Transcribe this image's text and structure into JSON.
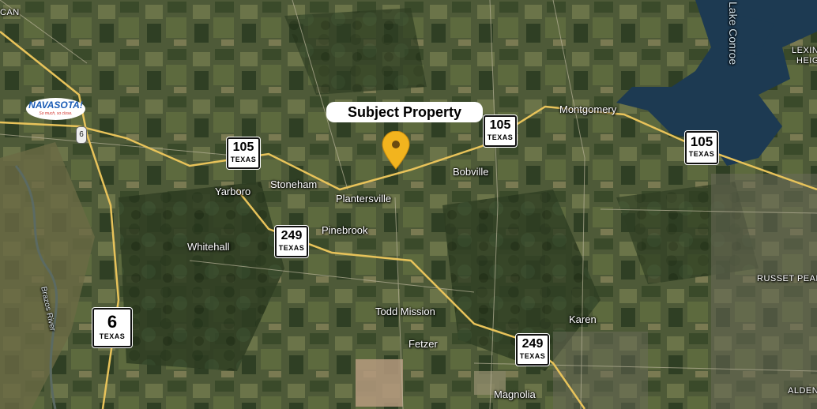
{
  "subject": {
    "label": "Subject Property"
  },
  "places": {
    "montgomery": "Montgomery",
    "bobville": "Bobville",
    "stoneham": "Stoneham",
    "plantersville": "Plantersville",
    "yarboro": "Yarboro",
    "whitehall": "Whitehall",
    "pinebrook": "Pinebrook",
    "todd_mission": "Todd Mission",
    "fetzer": "Fetzer",
    "karen": "Karen",
    "magnolia": "Magnolia",
    "russet_peak": "RUSSET PEAK",
    "alden": "ALDEN",
    "lexington_1": "LEXING",
    "lexington_2": "HEIG",
    "can": "CAN",
    "lake_conroe": "Lake Conroe",
    "brazos_river": "Brazos River"
  },
  "highways": {
    "hwy105_a": {
      "number": "105",
      "state": "TEXAS"
    },
    "hwy105_b": {
      "number": "105",
      "state": "TEXAS"
    },
    "hwy105_c": {
      "number": "105",
      "state": "TEXAS"
    },
    "hwy249_a": {
      "number": "249",
      "state": "TEXAS"
    },
    "hwy249_b": {
      "number": "249",
      "state": "TEXAS"
    },
    "hwy6": {
      "number": "6",
      "state": "TEXAS"
    },
    "us6_small": {
      "number": "6"
    }
  },
  "logo": {
    "brand": "NAVASOTA!",
    "tagline": "So much, so close."
  },
  "colors": {
    "pin": "#f2b41e",
    "road": "#e8c35a",
    "lake": "#1d3a52"
  }
}
